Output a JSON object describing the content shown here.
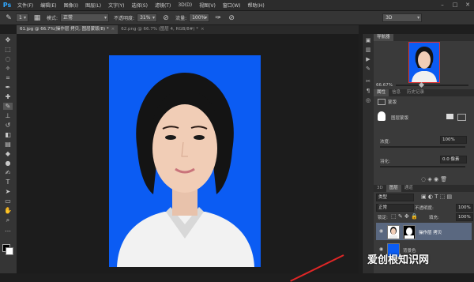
{
  "app": {
    "logo": "Ps"
  },
  "menu": [
    "文件(F)",
    "编辑(E)",
    "图像(I)",
    "图层(L)",
    "文字(Y)",
    "选择(S)",
    "滤镜(T)",
    "3D(D)",
    "视图(V)",
    "窗口(W)",
    "帮助(H)"
  ],
  "window_buttons": [
    "–",
    "□",
    "✕"
  ],
  "options": {
    "brush_size": "1",
    "mode_label": "模式:",
    "mode_value": "正常",
    "opacity_label": "不透明度:",
    "opacity_value": "31%",
    "flow_label": "流量:",
    "flow_value": "100%",
    "workspace_value": "3D"
  },
  "tabs": [
    {
      "label": "61.jpg @ 66.7%(操作层 拷贝, 图层蒙版/8) *",
      "active": true
    },
    {
      "label": "62.png @ 66.7% (图层 4, RGB/8#) *",
      "active": false
    }
  ],
  "navigator": {
    "tab": "导航器",
    "zoom": "66.67%"
  },
  "properties": {
    "tabs": [
      "属性",
      "信息",
      "历史记录"
    ],
    "section": "蒙版",
    "mask_label": "图层蒙版",
    "density_label": "浓度:",
    "density_value": "100%",
    "feather_label": "羽化:",
    "feather_value": "0.0 像素"
  },
  "layers_panel": {
    "tabs": [
      "3D",
      "图层",
      "通道"
    ],
    "filter_label": "类型",
    "blend_mode": "正常",
    "opacity_label": "不透明度:",
    "opacity_value": "100%",
    "lock_label": "锁定:",
    "fill_label": "填充:",
    "fill_value": "100%",
    "layers": [
      {
        "name": "操作层 拷贝",
        "selected": true
      },
      {
        "name": "背景色",
        "selected": false
      }
    ]
  },
  "watermark": "爱创根知识网",
  "colors": {
    "photo_background": "#0b5cf3",
    "accent_red": "#e02626",
    "selected_layer": "#5a6880"
  }
}
